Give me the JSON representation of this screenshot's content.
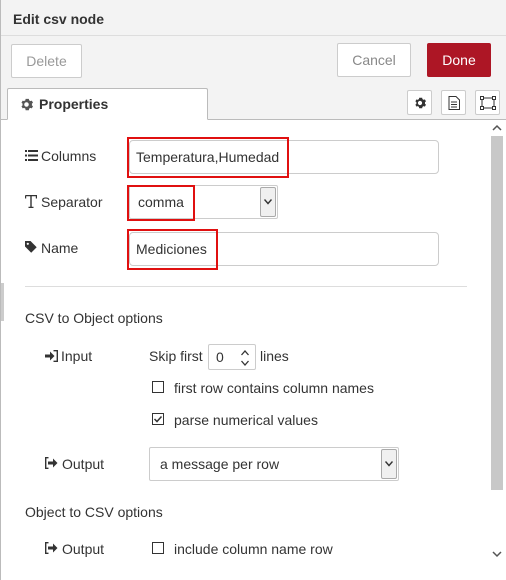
{
  "header": {
    "title": "Edit csv node"
  },
  "toolbar": {
    "delete_label": "Delete",
    "cancel_label": "Cancel",
    "done_label": "Done"
  },
  "tabs": {
    "properties_label": "Properties"
  },
  "form": {
    "columns": {
      "label": "Columns",
      "value": "Temperatura,Humedad"
    },
    "separator": {
      "label": "Separator",
      "value": "comma"
    },
    "name": {
      "label": "Name",
      "value": "Mediciones"
    }
  },
  "csv_to_object": {
    "title": "CSV to Object options",
    "input_label": "Input",
    "skip_first_label": "Skip first",
    "skip_first_value": "0",
    "lines_label": "lines",
    "first_row_label": "first row contains column names",
    "first_row_checked": false,
    "parse_numerical_label": "parse numerical values",
    "parse_numerical_checked": true,
    "output_label": "Output",
    "output_value": "a message per row"
  },
  "object_to_csv": {
    "title": "Object to CSV options",
    "output_label": "Output",
    "include_header_label": "include column name row",
    "include_header_checked": false
  },
  "colors": {
    "done_button": "#ad1625",
    "highlight": "#e01010"
  }
}
